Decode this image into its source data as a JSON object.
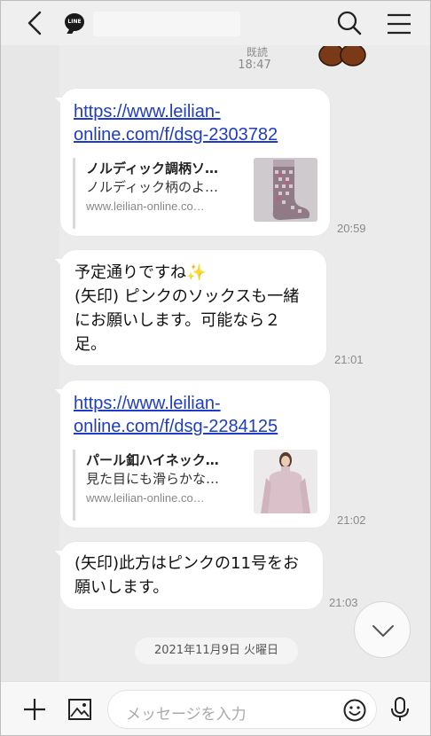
{
  "header": {
    "logo_text": "LINE",
    "back_icon": "chevron-left-icon",
    "search_icon": "search-icon",
    "menu_icon": "hamburger-menu-icon"
  },
  "top": {
    "read_label": "既読",
    "time": "18:47",
    "sticker": "bear-sticker"
  },
  "messages": [
    {
      "type": "link_preview",
      "url_line1": "https://www.leilian-",
      "url_line2": "online.com/f/dsg-2303782",
      "card_title": "ノルディック調柄ソ…",
      "card_desc": "ノルディック柄のよ…",
      "card_domain": "www.leilian-online.co…",
      "time": "20:59"
    },
    {
      "type": "text",
      "lines": [
        "予定通りですね✨",
        "(矢印) ピンクのソックスも一緒",
        "にお願いします。可能なら２",
        "足。"
      ],
      "time": "21:01"
    },
    {
      "type": "link_preview",
      "url_line1": "https://www.leilian-",
      "url_line2": "online.com/f/dsg-2284125",
      "card_title": "パール釦ハイネック…",
      "card_desc": "見た目にも滑らかな…",
      "card_domain": "www.leilian-online.co…",
      "time": "21:02"
    },
    {
      "type": "text",
      "lines": [
        "(矢印)此方はピンクの11号をお",
        "願いします。"
      ],
      "time": "21:03"
    }
  ],
  "date_separator": "2021年11月9日 火曜日",
  "input": {
    "placeholder": "メッセージを入力",
    "plus_icon": "plus-icon",
    "image_icon": "image-icon",
    "emoji_icon": "emoji-icon",
    "mic_icon": "microphone-icon"
  },
  "colors": {
    "background": "#ebebeb",
    "bubble": "#ffffff",
    "link": "#1f3cc9",
    "timestamp": "#8a8a8a"
  }
}
